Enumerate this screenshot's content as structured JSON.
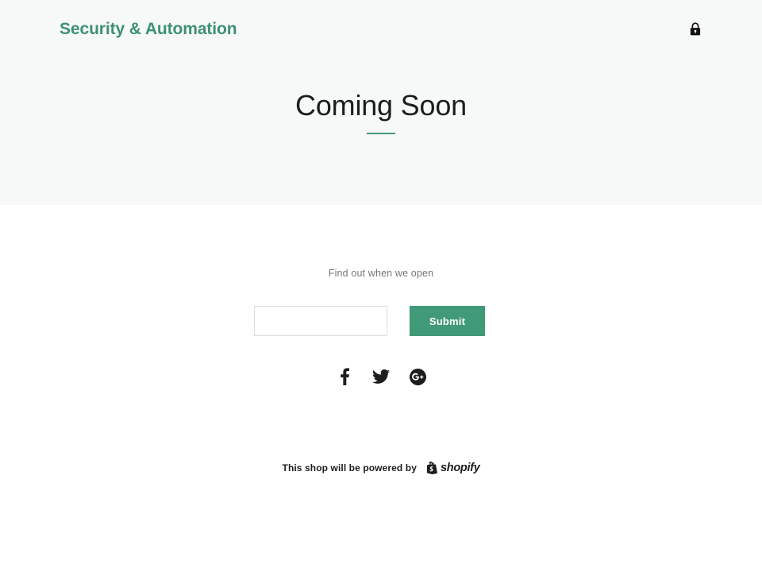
{
  "header": {
    "brand_title": "Security & Automation",
    "lock_icon": "lock-icon",
    "brand_color": "#3d9173"
  },
  "hero": {
    "title": "Coming Soon",
    "rule_color": "#46997b",
    "background_color": "#f7f8f8"
  },
  "signup": {
    "label": "Find out when we open",
    "email_placeholder": "",
    "email_value": "",
    "submit_label": "Submit",
    "submit_color": "#419a77"
  },
  "social": {
    "items": [
      {
        "name": "facebook-icon",
        "label": "Facebook"
      },
      {
        "name": "twitter-icon",
        "label": "Twitter"
      },
      {
        "name": "google-plus-icon",
        "label": "Google Plus"
      }
    ]
  },
  "footer": {
    "text": "This shop will be powered by",
    "shopify_wordmark": "shopify",
    "shopify_icon": "shopify-bag-icon"
  }
}
